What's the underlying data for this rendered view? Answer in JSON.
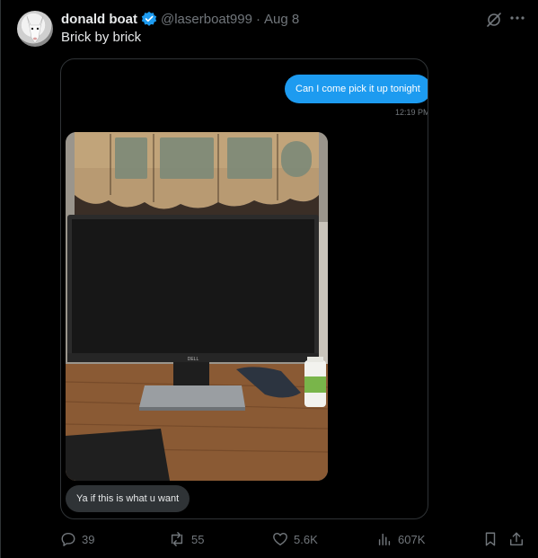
{
  "tweet": {
    "name": "donald boat",
    "handle": "@laserboat999",
    "separator": "·",
    "date": "Aug 8",
    "text": "Brick by brick"
  },
  "media": {
    "outgoing_message": "Can I come pick it up tonight",
    "outgoing_time": "12:19 PM",
    "incoming_message": "Ya if this is what u want",
    "photo_brand": "DELL"
  },
  "actions": {
    "replies": "39",
    "reposts": "55",
    "likes": "5.6K",
    "views": "607K"
  },
  "colors": {
    "accent": "#1d9bf0",
    "background": "#000000",
    "muted": "#71767b",
    "bubble_in": "#2f3336"
  },
  "icons": [
    "verified-badge-icon",
    "grok-icon",
    "more-icon",
    "reply-icon",
    "repost-icon",
    "like-icon",
    "views-icon",
    "bookmark-icon",
    "share-icon"
  ]
}
